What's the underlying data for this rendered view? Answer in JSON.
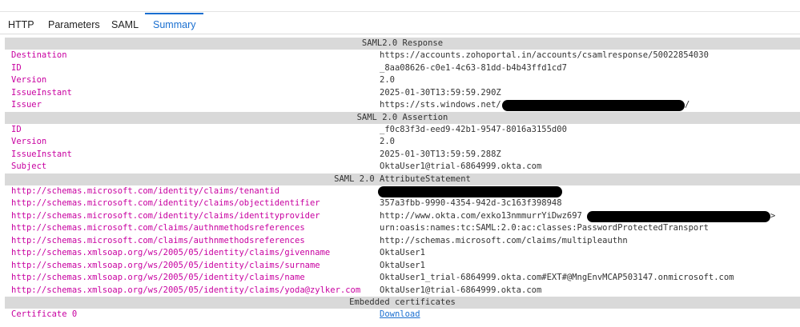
{
  "tabs": [
    "HTTP",
    "Parameters",
    "SAML",
    "Summary"
  ],
  "sections": {
    "response": {
      "title": "SAML2.0 Response",
      "rows": [
        {
          "key": "Destination",
          "value": "https://accounts.zohoportal.in/accounts/csamlresponse/50022854030"
        },
        {
          "key": "ID",
          "value": "_8aa08626-c0e1-4c63-81dd-b4b43ffd1cd7"
        },
        {
          "key": "Version",
          "value": "2.0"
        },
        {
          "key": "IssueInstant",
          "value": "2025-01-30T13:59:59.290Z"
        },
        {
          "key": "Issuer",
          "value": "https://sts.windows.net/",
          "tail": "/"
        }
      ]
    },
    "assertion": {
      "title": "SAML 2.0 Assertion",
      "rows": [
        {
          "key": "ID",
          "value": "_f0c83f3d-eed9-42b1-9547-8016a3155d00"
        },
        {
          "key": "Version",
          "value": "2.0"
        },
        {
          "key": "IssueInstant",
          "value": "2025-01-30T13:59:59.288Z"
        },
        {
          "key": "Subject",
          "value": "OktaUser1@trial-6864999.okta.com"
        }
      ]
    },
    "attributes": {
      "title": "SAML 2.0 AttributeStatement",
      "rows": [
        {
          "key": "http://schemas.microsoft.com/identity/claims/tenantid",
          "value": ""
        },
        {
          "key": "http://schemas.microsoft.com/identity/claims/objectidentifier",
          "value": "357a3fbb-9990-4354-942d-3c163f398948"
        },
        {
          "key": "http://schemas.microsoft.com/identity/claims/identityprovider",
          "value": "http://www.okta.com/exko13nmmurrYiDwz697",
          "tail": ">"
        },
        {
          "key": "http://schemas.microsoft.com/claims/authnmethodsreferences",
          "value": "urn:oasis:names:tc:SAML:2.0:ac:classes:PasswordProtectedTransport"
        },
        {
          "key": "http://schemas.microsoft.com/claims/authnmethodsreferences",
          "value": "http://schemas.microsoft.com/claims/multipleauthn"
        },
        {
          "key": "http://schemas.xmlsoap.org/ws/2005/05/identity/claims/givenname",
          "value": "OktaUser1"
        },
        {
          "key": "http://schemas.xmlsoap.org/ws/2005/05/identity/claims/surname",
          "value": "OktaUser1"
        },
        {
          "key": "http://schemas.xmlsoap.org/ws/2005/05/identity/claims/name",
          "value": "OktaUser1_trial-6864999.okta.com#EXT#@MngEnvMCAP503147.onmicrosoft.com"
        },
        {
          "key": "http://schemas.xmlsoap.org/ws/2005/05/identity/claims/yoda@zylker.com",
          "value": "OktaUser1@trial-6864999.okta.com"
        }
      ]
    },
    "certs": {
      "title": "Embedded certificates",
      "rows": [
        {
          "key": "Certificate 0",
          "value": "Download"
        }
      ]
    }
  }
}
